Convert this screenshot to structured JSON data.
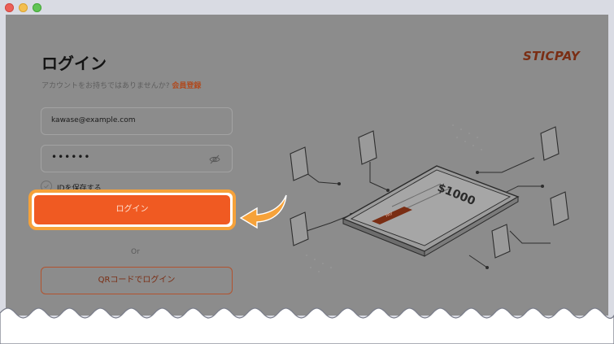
{
  "window": {
    "buttons": [
      "close",
      "minimize",
      "zoom"
    ]
  },
  "brand": {
    "logo": "STICPAY",
    "accent_color": "#f05a22",
    "highlight_color": "#f6a23a"
  },
  "login": {
    "title": "ログイン",
    "subtitle_prefix": "アカウントをお持ちではありませんか?",
    "register_link": "会員登録",
    "email_value": "kawase@example.com",
    "password_value": "••••••",
    "remember_label": "IDを保存する",
    "submit_label": "ログイン",
    "or_label": "Or",
    "qr_label": "QRコードでログイン"
  },
  "illustration": {
    "amount": "$1000",
    "pay_label": "PAY"
  }
}
